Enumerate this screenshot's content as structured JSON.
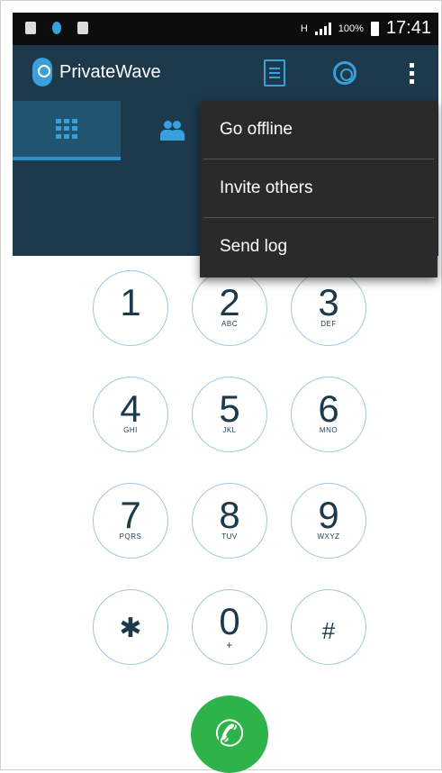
{
  "status_bar": {
    "battery_percent": "100%",
    "time": "17:41",
    "network": "H"
  },
  "app": {
    "title": "PrivateWave"
  },
  "overflow_menu": {
    "items": [
      {
        "label": "Go offline"
      },
      {
        "label": "Invite others"
      },
      {
        "label": "Send log"
      }
    ]
  },
  "dialpad": {
    "keys": [
      {
        "digit": "1",
        "letters": ""
      },
      {
        "digit": "2",
        "letters": "ABC"
      },
      {
        "digit": "3",
        "letters": "DEF"
      },
      {
        "digit": "4",
        "letters": "GHI"
      },
      {
        "digit": "5",
        "letters": "JKL"
      },
      {
        "digit": "6",
        "letters": "MNO"
      },
      {
        "digit": "7",
        "letters": "PQRS"
      },
      {
        "digit": "8",
        "letters": "TUV"
      },
      {
        "digit": "9",
        "letters": "WXYZ"
      },
      {
        "digit": "✱",
        "letters": ""
      },
      {
        "digit": "0",
        "letters": "+"
      },
      {
        "digit": "#",
        "letters": ""
      }
    ]
  },
  "colors": {
    "header": "#1c3a4c",
    "accent": "#3aa0dc",
    "call": "#2db34a",
    "menu": "#2a2a2a"
  },
  "icons": {
    "call_button": "phone-icon",
    "tab_dialpad": "grid-icon",
    "tab_contacts": "contacts-icon"
  }
}
